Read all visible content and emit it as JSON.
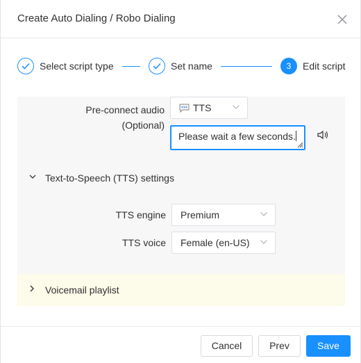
{
  "dialog": {
    "title": "Create Auto Dialing / Robo Dialing",
    "close_icon": "close-icon"
  },
  "steps": [
    {
      "label": "Select script type",
      "status": "done"
    },
    {
      "label": "Set name",
      "status": "done"
    },
    {
      "number": "3",
      "label": "Edit script",
      "status": "active"
    }
  ],
  "preconnect": {
    "label_line1": "Pre-connect audio",
    "label_line2": "(Optional)",
    "type_value": "TTS",
    "type_icon": "chat-bubble-icon",
    "text_value": "Please wait a few seconds.",
    "play_icon": "speaker-icon"
  },
  "tts_settings": {
    "title": "Text-to-Speech (TTS) settings",
    "expanded": true,
    "engine_label": "TTS engine",
    "engine_value": "Premium",
    "voice_label": "TTS voice",
    "voice_value": "Female (en-US)"
  },
  "voicemail": {
    "title": "Voicemail playlist",
    "expanded": false
  },
  "footer": {
    "cancel_label": "Cancel",
    "prev_label": "Prev",
    "save_label": "Save"
  },
  "colors": {
    "accent": "#1890ff",
    "panel_background": "#f7f7f7",
    "voicemail_background": "#fdfbe9"
  }
}
